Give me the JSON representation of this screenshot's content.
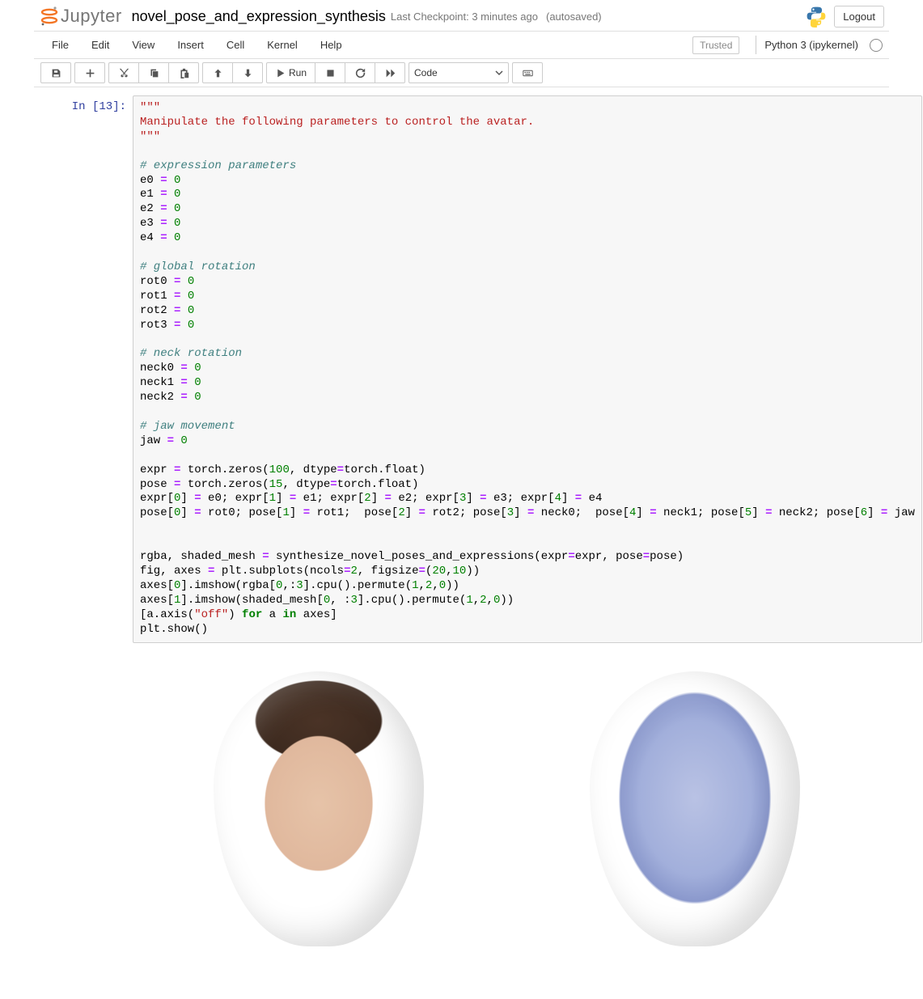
{
  "header": {
    "logo_text": "Jupyter",
    "notebook_name": "novel_pose_and_expression_synthesis",
    "checkpoint": "Last Checkpoint: 3 minutes ago",
    "autosave": "(autosaved)",
    "logout": "Logout"
  },
  "menubar": {
    "items": [
      "File",
      "Edit",
      "View",
      "Insert",
      "Cell",
      "Kernel",
      "Help"
    ],
    "trusted": "Trusted",
    "kernel": "Python 3 (ipykernel)"
  },
  "toolbar": {
    "run_label": "Run",
    "celltype": "Code"
  },
  "cell": {
    "prompt": "In [13]:",
    "tokens": [
      {
        "t": "str",
        "v": "\"\"\""
      },
      {
        "t": "",
        "v": "\n"
      },
      {
        "t": "str",
        "v": "Manipulate the following parameters to control the avatar."
      },
      {
        "t": "",
        "v": "\n"
      },
      {
        "t": "str",
        "v": "\"\"\""
      },
      {
        "t": "",
        "v": "\n\n"
      },
      {
        "t": "com",
        "v": "# expression parameters"
      },
      {
        "t": "",
        "v": "\n"
      },
      {
        "t": "",
        "v": "e0 "
      },
      {
        "t": "op",
        "v": "="
      },
      {
        "t": "",
        "v": " "
      },
      {
        "t": "num",
        "v": "0"
      },
      {
        "t": "",
        "v": "\n"
      },
      {
        "t": "",
        "v": "e1 "
      },
      {
        "t": "op",
        "v": "="
      },
      {
        "t": "",
        "v": " "
      },
      {
        "t": "num",
        "v": "0"
      },
      {
        "t": "",
        "v": "\n"
      },
      {
        "t": "",
        "v": "e2 "
      },
      {
        "t": "op",
        "v": "="
      },
      {
        "t": "",
        "v": " "
      },
      {
        "t": "num",
        "v": "0"
      },
      {
        "t": "",
        "v": "\n"
      },
      {
        "t": "",
        "v": "e3 "
      },
      {
        "t": "op",
        "v": "="
      },
      {
        "t": "",
        "v": " "
      },
      {
        "t": "num",
        "v": "0"
      },
      {
        "t": "",
        "v": "\n"
      },
      {
        "t": "",
        "v": "e4 "
      },
      {
        "t": "op",
        "v": "="
      },
      {
        "t": "",
        "v": " "
      },
      {
        "t": "num",
        "v": "0"
      },
      {
        "t": "",
        "v": "\n\n"
      },
      {
        "t": "com",
        "v": "# global rotation"
      },
      {
        "t": "",
        "v": "\n"
      },
      {
        "t": "",
        "v": "rot0 "
      },
      {
        "t": "op",
        "v": "="
      },
      {
        "t": "",
        "v": " "
      },
      {
        "t": "num",
        "v": "0"
      },
      {
        "t": "",
        "v": "\n"
      },
      {
        "t": "",
        "v": "rot1 "
      },
      {
        "t": "op",
        "v": "="
      },
      {
        "t": "",
        "v": " "
      },
      {
        "t": "num",
        "v": "0"
      },
      {
        "t": "",
        "v": "\n"
      },
      {
        "t": "",
        "v": "rot2 "
      },
      {
        "t": "op",
        "v": "="
      },
      {
        "t": "",
        "v": " "
      },
      {
        "t": "num",
        "v": "0"
      },
      {
        "t": "",
        "v": "\n"
      },
      {
        "t": "",
        "v": "rot3 "
      },
      {
        "t": "op",
        "v": "="
      },
      {
        "t": "",
        "v": " "
      },
      {
        "t": "num",
        "v": "0"
      },
      {
        "t": "",
        "v": "\n\n"
      },
      {
        "t": "com",
        "v": "# neck rotation"
      },
      {
        "t": "",
        "v": "\n"
      },
      {
        "t": "",
        "v": "neck0 "
      },
      {
        "t": "op",
        "v": "="
      },
      {
        "t": "",
        "v": " "
      },
      {
        "t": "num",
        "v": "0"
      },
      {
        "t": "",
        "v": "\n"
      },
      {
        "t": "",
        "v": "neck1 "
      },
      {
        "t": "op",
        "v": "="
      },
      {
        "t": "",
        "v": " "
      },
      {
        "t": "num",
        "v": "0"
      },
      {
        "t": "",
        "v": "\n"
      },
      {
        "t": "",
        "v": "neck2 "
      },
      {
        "t": "op",
        "v": "="
      },
      {
        "t": "",
        "v": " "
      },
      {
        "t": "num",
        "v": "0"
      },
      {
        "t": "",
        "v": "\n\n"
      },
      {
        "t": "com",
        "v": "# jaw movement"
      },
      {
        "t": "",
        "v": "\n"
      },
      {
        "t": "",
        "v": "jaw "
      },
      {
        "t": "op",
        "v": "="
      },
      {
        "t": "",
        "v": " "
      },
      {
        "t": "num",
        "v": "0"
      },
      {
        "t": "",
        "v": "\n\n"
      },
      {
        "t": "",
        "v": "expr "
      },
      {
        "t": "op",
        "v": "="
      },
      {
        "t": "",
        "v": " torch.zeros("
      },
      {
        "t": "num",
        "v": "100"
      },
      {
        "t": "",
        "v": ", dtype"
      },
      {
        "t": "op",
        "v": "="
      },
      {
        "t": "",
        "v": "torch.float)\n"
      },
      {
        "t": "",
        "v": "pose "
      },
      {
        "t": "op",
        "v": "="
      },
      {
        "t": "",
        "v": " torch.zeros("
      },
      {
        "t": "num",
        "v": "15"
      },
      {
        "t": "",
        "v": ", dtype"
      },
      {
        "t": "op",
        "v": "="
      },
      {
        "t": "",
        "v": "torch.float)\n"
      },
      {
        "t": "",
        "v": "expr["
      },
      {
        "t": "num",
        "v": "0"
      },
      {
        "t": "",
        "v": "] "
      },
      {
        "t": "op",
        "v": "="
      },
      {
        "t": "",
        "v": " e0; expr["
      },
      {
        "t": "num",
        "v": "1"
      },
      {
        "t": "",
        "v": "] "
      },
      {
        "t": "op",
        "v": "="
      },
      {
        "t": "",
        "v": " e1; expr["
      },
      {
        "t": "num",
        "v": "2"
      },
      {
        "t": "",
        "v": "] "
      },
      {
        "t": "op",
        "v": "="
      },
      {
        "t": "",
        "v": " e2; expr["
      },
      {
        "t": "num",
        "v": "3"
      },
      {
        "t": "",
        "v": "] "
      },
      {
        "t": "op",
        "v": "="
      },
      {
        "t": "",
        "v": " e3; expr["
      },
      {
        "t": "num",
        "v": "4"
      },
      {
        "t": "",
        "v": "] "
      },
      {
        "t": "op",
        "v": "="
      },
      {
        "t": "",
        "v": " e4\n"
      },
      {
        "t": "",
        "v": "pose["
      },
      {
        "t": "num",
        "v": "0"
      },
      {
        "t": "",
        "v": "] "
      },
      {
        "t": "op",
        "v": "="
      },
      {
        "t": "",
        "v": " rot0; pose["
      },
      {
        "t": "num",
        "v": "1"
      },
      {
        "t": "",
        "v": "] "
      },
      {
        "t": "op",
        "v": "="
      },
      {
        "t": "",
        "v": " rot1;  pose["
      },
      {
        "t": "num",
        "v": "2"
      },
      {
        "t": "",
        "v": "] "
      },
      {
        "t": "op",
        "v": "="
      },
      {
        "t": "",
        "v": " rot2; pose["
      },
      {
        "t": "num",
        "v": "3"
      },
      {
        "t": "",
        "v": "] "
      },
      {
        "t": "op",
        "v": "="
      },
      {
        "t": "",
        "v": " neck0;  pose["
      },
      {
        "t": "num",
        "v": "4"
      },
      {
        "t": "",
        "v": "] "
      },
      {
        "t": "op",
        "v": "="
      },
      {
        "t": "",
        "v": " neck1; pose["
      },
      {
        "t": "num",
        "v": "5"
      },
      {
        "t": "",
        "v": "] "
      },
      {
        "t": "op",
        "v": "="
      },
      {
        "t": "",
        "v": " neck2; pose["
      },
      {
        "t": "num",
        "v": "6"
      },
      {
        "t": "",
        "v": "] "
      },
      {
        "t": "op",
        "v": "="
      },
      {
        "t": "",
        "v": " jaw\n\n\n"
      },
      {
        "t": "",
        "v": "rgba, shaded_mesh "
      },
      {
        "t": "op",
        "v": "="
      },
      {
        "t": "",
        "v": " synthesize_novel_poses_and_expressions(expr"
      },
      {
        "t": "op",
        "v": "="
      },
      {
        "t": "",
        "v": "expr, pose"
      },
      {
        "t": "op",
        "v": "="
      },
      {
        "t": "",
        "v": "pose)\n"
      },
      {
        "t": "",
        "v": "fig, axes "
      },
      {
        "t": "op",
        "v": "="
      },
      {
        "t": "",
        "v": " plt.subplots(ncols"
      },
      {
        "t": "op",
        "v": "="
      },
      {
        "t": "num",
        "v": "2"
      },
      {
        "t": "",
        "v": ", figsize"
      },
      {
        "t": "op",
        "v": "="
      },
      {
        "t": "",
        "v": "("
      },
      {
        "t": "num",
        "v": "20"
      },
      {
        "t": "",
        "v": ","
      },
      {
        "t": "num",
        "v": "10"
      },
      {
        "t": "",
        "v": "))\n"
      },
      {
        "t": "",
        "v": "axes["
      },
      {
        "t": "num",
        "v": "0"
      },
      {
        "t": "",
        "v": "].imshow(rgba["
      },
      {
        "t": "num",
        "v": "0"
      },
      {
        "t": "",
        "v": ",:"
      },
      {
        "t": "num",
        "v": "3"
      },
      {
        "t": "",
        "v": "].cpu().permute("
      },
      {
        "t": "num",
        "v": "1"
      },
      {
        "t": "",
        "v": ","
      },
      {
        "t": "num",
        "v": "2"
      },
      {
        "t": "",
        "v": ","
      },
      {
        "t": "num",
        "v": "0"
      },
      {
        "t": "",
        "v": "))\n"
      },
      {
        "t": "",
        "v": "axes["
      },
      {
        "t": "num",
        "v": "1"
      },
      {
        "t": "",
        "v": "].imshow(shaded_mesh["
      },
      {
        "t": "num",
        "v": "0"
      },
      {
        "t": "",
        "v": ", :"
      },
      {
        "t": "num",
        "v": "3"
      },
      {
        "t": "",
        "v": "].cpu().permute("
      },
      {
        "t": "num",
        "v": "1"
      },
      {
        "t": "",
        "v": ","
      },
      {
        "t": "num",
        "v": "2"
      },
      {
        "t": "",
        "v": ","
      },
      {
        "t": "num",
        "v": "0"
      },
      {
        "t": "",
        "v": "))\n"
      },
      {
        "t": "",
        "v": "[a.axis("
      },
      {
        "t": "str",
        "v": "\"off\""
      },
      {
        "t": "",
        "v": ") "
      },
      {
        "t": "kw",
        "v": "for"
      },
      {
        "t": "",
        "v": " a "
      },
      {
        "t": "kw",
        "v": "in"
      },
      {
        "t": "",
        "v": " axes]\n"
      },
      {
        "t": "",
        "v": "plt.show()"
      }
    ]
  },
  "output": {
    "left_alt": "Rendered textured avatar head (RGB)",
    "right_alt": "Shaded untextured mesh head (3D geometry)"
  }
}
